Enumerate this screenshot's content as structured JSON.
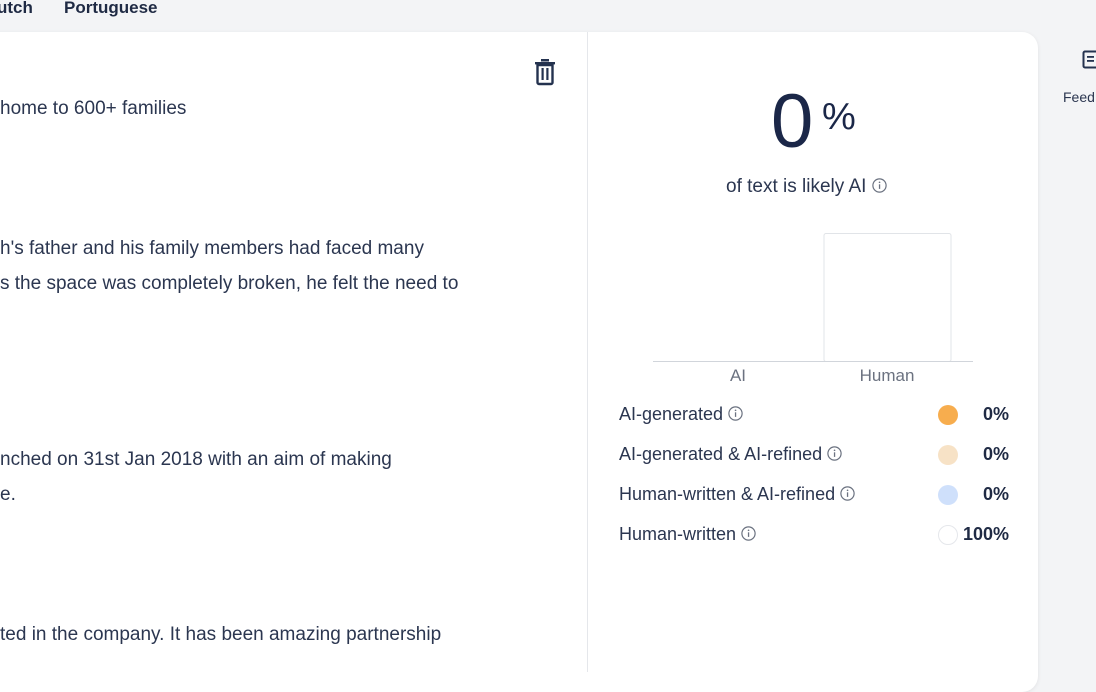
{
  "tabs": [
    "utch",
    "Portuguese"
  ],
  "editor": {
    "lines": [
      " home to 600+ families",
      "h's father and his family members had faced many",
      "s the space was completely broken, he felt the need to",
      "nched on 31st Jan 2018 with an aim of making",
      "e.",
      "ted in the company. It has been amazing partnership"
    ],
    "delete_icon": "trash-icon"
  },
  "result": {
    "percent": "0",
    "percent_sign": "%",
    "subtitle": "of text is likely AI",
    "info_icon": "info-icon"
  },
  "chart_data": {
    "type": "bar",
    "categories": [
      "AI",
      "Human"
    ],
    "values": [
      0,
      100
    ],
    "ylim": [
      0,
      100
    ],
    "title": "",
    "xlabel": "",
    "ylabel": ""
  },
  "legend": [
    {
      "label": "AI-generated",
      "value": "0%",
      "color": "#f7ad4e"
    },
    {
      "label": "AI-generated & AI-refined",
      "value": "0%",
      "color": "#f7e2c6"
    },
    {
      "label": "Human-written & AI-refined",
      "value": "0%",
      "color": "#cfe0fb"
    },
    {
      "label": "Human-written",
      "value": "100%",
      "color": "#ffffff"
    }
  ],
  "rail": {
    "label": "Feed",
    "icon": "document-list-icon"
  }
}
